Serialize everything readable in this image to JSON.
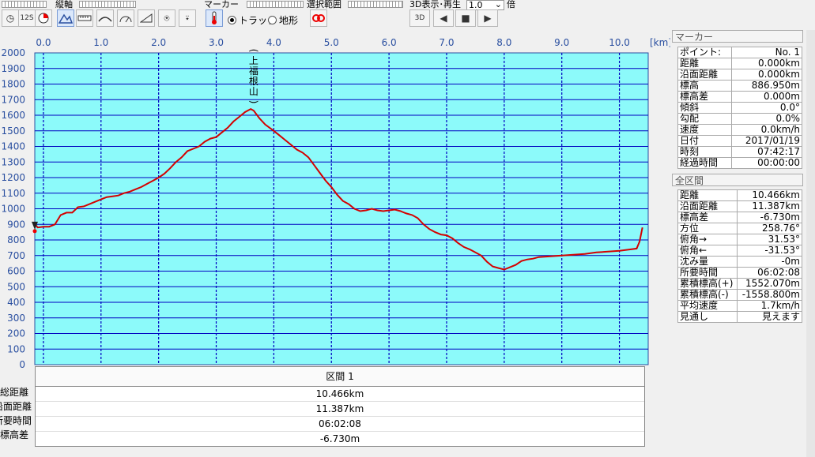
{
  "toolbar": {
    "vertical_axis_label": "縦軸",
    "marker_label": "マーカー",
    "range_label": "選択範囲",
    "playback_label": "3D表示･再生",
    "speed_value": "1.0",
    "speed_unit": "倍",
    "radio_track": "トラック",
    "radio_terrain": "地形",
    "selected_radio": "track",
    "three_d_label": "3D",
    "clock_label": "12S"
  },
  "chart_data": {
    "type": "line",
    "xlabel": "[km]",
    "ylabel": "",
    "xlim": [
      -0.15,
      10.5
    ],
    "ylim": [
      0,
      2000
    ],
    "x_ticks": [
      0.0,
      1.0,
      2.0,
      3.0,
      4.0,
      5.0,
      6.0,
      7.0,
      8.0,
      9.0,
      10.0
    ],
    "x_tick_labels": [
      "0.0",
      "1.0",
      "2.0",
      "3.0",
      "4.0",
      "5.0",
      "6.0",
      "7.0",
      "8.0",
      "9.0",
      "10.0"
    ],
    "y_ticks": [
      0,
      100,
      200,
      300,
      400,
      500,
      600,
      700,
      800,
      900,
      1000,
      1100,
      1200,
      1300,
      1400,
      1500,
      1600,
      1700,
      1800,
      1900,
      2000
    ],
    "grid": true,
    "annotations": [
      {
        "text": "(上福根山)",
        "x": 3.65,
        "y": 1640
      }
    ],
    "series": [
      {
        "color": "#d40000",
        "x": [
          -0.15,
          -0.1,
          0.0,
          0.1,
          0.2,
          0.3,
          0.4,
          0.5,
          0.6,
          0.7,
          0.8,
          0.9,
          1.0,
          1.1,
          1.2,
          1.3,
          1.4,
          1.5,
          1.6,
          1.7,
          1.8,
          1.9,
          2.0,
          2.1,
          2.2,
          2.3,
          2.4,
          2.5,
          2.6,
          2.7,
          2.8,
          2.9,
          3.0,
          3.1,
          3.2,
          3.3,
          3.4,
          3.5,
          3.6,
          3.65,
          3.75,
          3.85,
          4.0,
          4.1,
          4.2,
          4.3,
          4.4,
          4.5,
          4.6,
          4.7,
          4.8,
          4.9,
          5.0,
          5.1,
          5.2,
          5.3,
          5.4,
          5.5,
          5.6,
          5.7,
          5.8,
          5.9,
          6.0,
          6.1,
          6.2,
          6.3,
          6.4,
          6.5,
          6.6,
          6.7,
          6.8,
          6.9,
          7.0,
          7.1,
          7.2,
          7.3,
          7.4,
          7.5,
          7.6,
          7.7,
          7.8,
          7.9,
          8.0,
          8.1,
          8.2,
          8.3,
          8.4,
          8.5,
          8.6,
          8.8,
          9.0,
          9.2,
          9.4,
          9.6,
          9.8,
          10.0,
          10.2,
          10.3,
          10.35,
          10.4
        ],
        "y": [
          905,
          880,
          885,
          885,
          900,
          960,
          975,
          975,
          1010,
          1015,
          1030,
          1045,
          1060,
          1075,
          1080,
          1085,
          1100,
          1110,
          1125,
          1140,
          1160,
          1180,
          1200,
          1225,
          1260,
          1300,
          1330,
          1370,
          1385,
          1400,
          1430,
          1450,
          1460,
          1490,
          1520,
          1560,
          1590,
          1620,
          1640,
          1630,
          1580,
          1540,
          1500,
          1470,
          1440,
          1410,
          1380,
          1360,
          1330,
          1280,
          1230,
          1180,
          1140,
          1090,
          1050,
          1030,
          1000,
          985,
          990,
          1000,
          990,
          985,
          990,
          995,
          985,
          970,
          960,
          940,
          900,
          870,
          850,
          835,
          830,
          810,
          780,
          755,
          740,
          720,
          700,
          660,
          630,
          620,
          610,
          625,
          640,
          665,
          675,
          680,
          690,
          695,
          700,
          705,
          710,
          720,
          725,
          730,
          740,
          745,
          790,
          880
        ]
      }
    ],
    "marker": {
      "x": -0.15,
      "y": 887
    }
  },
  "section": {
    "header": "区間 1",
    "labels": [
      "総距離",
      "沿面距離",
      "所要時間",
      "標高差"
    ],
    "values": [
      "10.466km",
      "11.387km",
      "06:02:08",
      "-6.730m"
    ]
  },
  "marker_panel": {
    "title": "マーカー",
    "rows": [
      {
        "label": "ポイント:",
        "value": "No. 1"
      },
      {
        "label": "距離",
        "value": "0.000km"
      },
      {
        "label": "沿面距離",
        "value": "0.000km"
      },
      {
        "label": "標高",
        "value": "886.950m"
      },
      {
        "label": "標高差",
        "value": "0.000m"
      },
      {
        "label": "傾斜",
        "value": "0.0°"
      },
      {
        "label": "勾配",
        "value": "0.0%"
      },
      {
        "label": "速度",
        "value": "0.0km/h"
      },
      {
        "label": "日付",
        "value": "2017/01/19"
      },
      {
        "label": "時刻",
        "value": "07:42:17"
      },
      {
        "label": "経過時間",
        "value": "00:00:00"
      }
    ]
  },
  "whole_panel": {
    "title": "全区間",
    "rows": [
      {
        "label": "距離",
        "value": "10.466km"
      },
      {
        "label": "沿面距離",
        "value": "11.387km"
      },
      {
        "label": "標高差",
        "value": "-6.730m"
      },
      {
        "label": "方位",
        "value": "258.76°"
      },
      {
        "label": "俯角→",
        "value": "31.53°"
      },
      {
        "label": "俯角←",
        "value": "-31.53°"
      },
      {
        "label": "沈み量",
        "value": "-0m"
      },
      {
        "label": "所要時間",
        "value": "06:02:08"
      },
      {
        "label": "累積標高(+)",
        "value": "1552.070m"
      },
      {
        "label": "累積標高(-)",
        "value": "-1558.800m"
      },
      {
        "label": "平均速度",
        "value": "1.7km/h"
      },
      {
        "label": "見通し",
        "value": "見えます"
      }
    ]
  },
  "colors": {
    "plot_bg": "#8cfafa",
    "grid": "#0000c0",
    "line": "#d40000",
    "axis_text": "#2a4fa0"
  }
}
